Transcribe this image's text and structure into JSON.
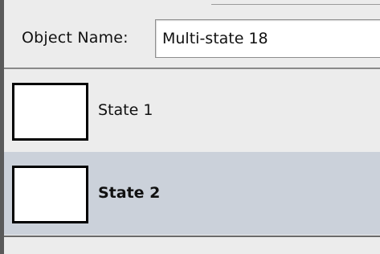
{
  "object_name": {
    "label": "Object Name:",
    "value": "Multi-state 18"
  },
  "states": [
    {
      "label": "State 1",
      "selected": false
    },
    {
      "label": "State 2",
      "selected": true
    }
  ],
  "colors": {
    "panel_bg": "#ececec",
    "selected_row_bg": "#cbd1da",
    "thumbnail_border": "#000000"
  }
}
